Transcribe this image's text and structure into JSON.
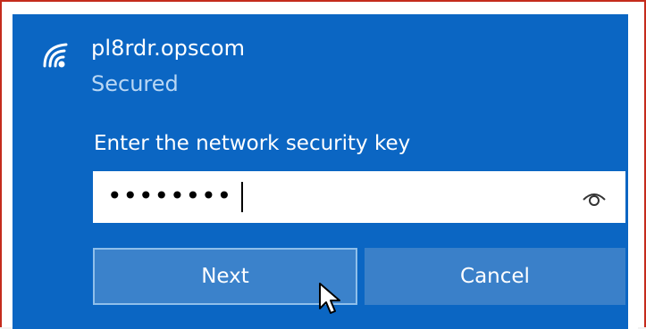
{
  "network": {
    "ssid": "pl8rdr.opscom",
    "status": "Secured"
  },
  "security_key": {
    "prompt": "Enter the network security key",
    "masked_value": "••••••••"
  },
  "buttons": {
    "next_label": "Next",
    "cancel_label": "Cancel"
  },
  "icons": {
    "network": "wifi-icon",
    "reveal_password": "eye-icon",
    "pointer": "mouse-cursor-icon"
  },
  "colors": {
    "panel": "#0b66c3",
    "button": "#3b82cb",
    "frame_border": "#c42b1c"
  }
}
